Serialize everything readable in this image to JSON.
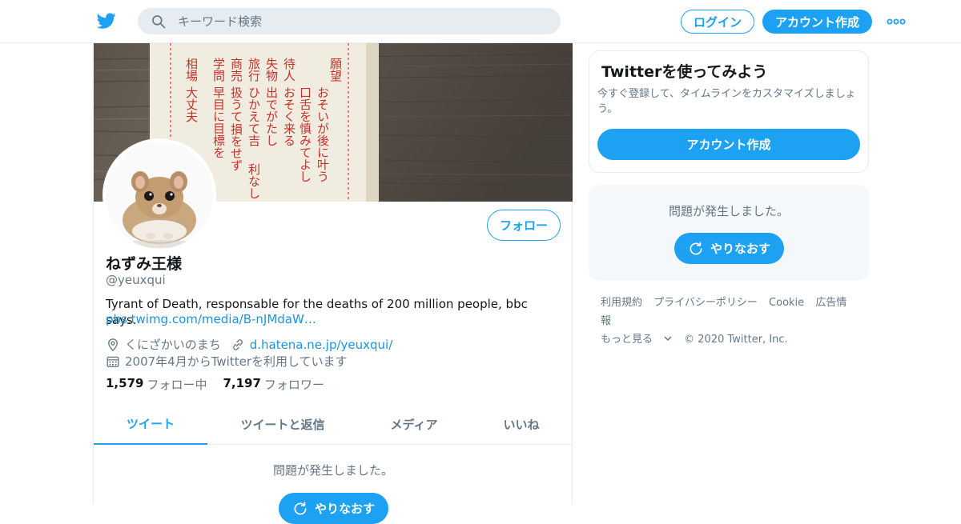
{
  "search": {
    "placeholder": "キーワード検索"
  },
  "header": {
    "login_label": "ログイン",
    "signup_label": "アカウント作成"
  },
  "profile": {
    "banner_text": [
      "願望",
      "おそいが後に叶う",
      "口舌を慎みてよし",
      "待人",
      "おそく来る",
      "失物",
      "出でがたし",
      "旅行",
      "ひかえて吉",
      "利なし",
      "商売",
      "扱うて",
      "損をせず",
      "学問",
      "早目に目標を",
      "相場",
      "大丈夫"
    ],
    "follow_label": "フォロー",
    "name": "ねずみ王様",
    "handle": "@yeuxqui",
    "bio": "Tyrant of Death, responsable for the deaths of 200 million people, bbc says.",
    "bio_link": "pbs.twimg.com/media/B-nJMdaW…",
    "location": "くにざかいのまち",
    "website": "d.hatena.ne.jp/yeuxqui/",
    "joined": "2007年4月からTwitterを利用しています",
    "following_count": "1,579",
    "following_label": "フォロー中",
    "followers_count": "7,197",
    "followers_label": "フォロワー"
  },
  "tabs": [
    {
      "label": "ツイート",
      "active": true
    },
    {
      "label": "ツイートと返信",
      "active": false
    },
    {
      "label": "メディア",
      "active": false
    },
    {
      "label": "いいね",
      "active": false
    }
  ],
  "timeline": {
    "error_text": "問題が発生しました。",
    "retry_label": "やりなおす"
  },
  "sidebar": {
    "card_title": "Twitterを使ってみよう",
    "card_desc": "今すぐ登録して、タイムラインをカスタマイズしましょう。",
    "card_button": "アカウント作成",
    "error_text": "問題が発生しました。",
    "retry_label": "やりなおす",
    "footer_links": [
      "利用規約",
      "プライバシーポリシー",
      "Cookie",
      "広告情報",
      "もっと見る"
    ],
    "copyright": "© 2020 Twitter, Inc."
  },
  "colors": {
    "accent": "#1da1f2",
    "muted": "#657786",
    "border": "#e6ecf0"
  },
  "icons": [
    "twitter-bird-icon",
    "search-icon",
    "more-icon",
    "location-icon",
    "link-icon",
    "calendar-icon",
    "refresh-icon",
    "chevron-down-icon"
  ]
}
